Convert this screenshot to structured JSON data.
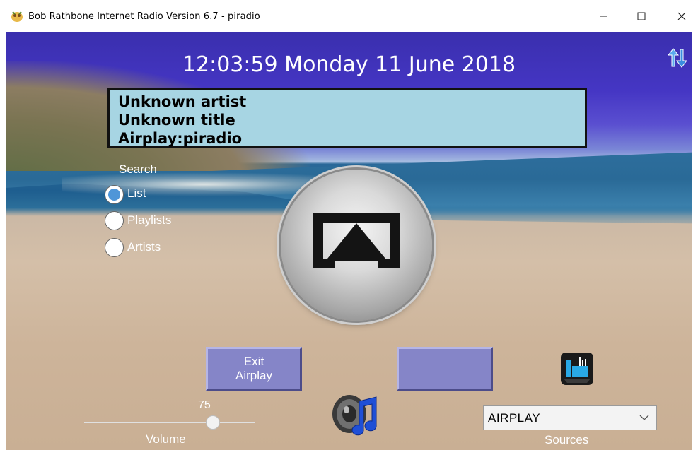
{
  "window": {
    "title": "Bob Rathbone Internet Radio Version 6.7 - piradio",
    "icons": {
      "app": "pi-app-icon",
      "minimize": "minimize-icon",
      "maximize": "maximize-icon",
      "close": "close-icon"
    }
  },
  "header": {
    "datetime": "12:03:59 Monday 11 June 2018",
    "swap_icon": "swap-arrows-icon"
  },
  "info": {
    "artist": "Unknown artist",
    "title": "Unknown title",
    "station": "Airplay:piradio"
  },
  "search": {
    "label": "Search",
    "options": [
      {
        "label": "List",
        "selected": true
      },
      {
        "label": "Playlists",
        "selected": false
      },
      {
        "label": "Artists",
        "selected": false
      }
    ]
  },
  "center": {
    "icon": "airplay-icon"
  },
  "buttons": {
    "exit_line1": "Exit",
    "exit_line2": "Airplay",
    "blank": ""
  },
  "volume": {
    "value": "75",
    "label": "Volume",
    "level_percent": 75
  },
  "sources": {
    "selected": "AIRPLAY",
    "label": "Sources"
  },
  "icons": {
    "equalizer": "equalizer-app-icon",
    "speaker": "speaker-music-icon"
  },
  "colors": {
    "info_bg": "#a7d5e3",
    "button_bg": "#8585c8",
    "radio_selected": "#4f96d8",
    "sky": "#4536c4"
  }
}
